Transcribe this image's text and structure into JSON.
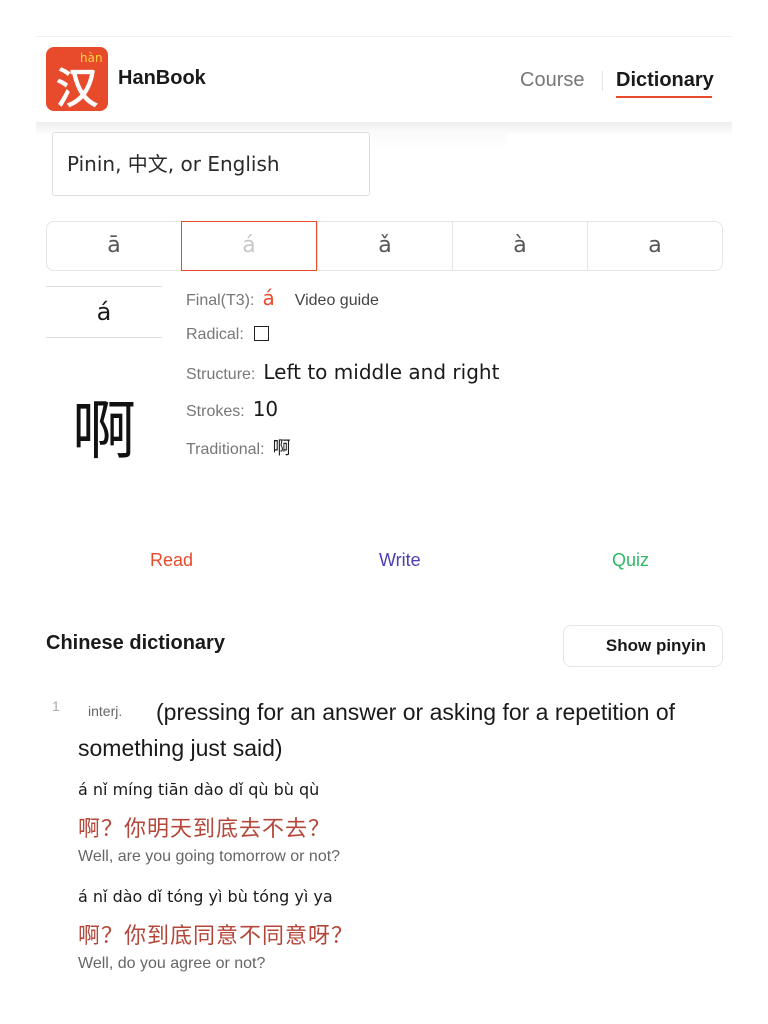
{
  "header": {
    "logo_sup": "hàn",
    "logo_char": "汉",
    "app_name": "HanBook",
    "nav": {
      "course": "Course",
      "dictionary": "Dictionary"
    }
  },
  "search": {
    "placeholder": "Pinin, 中文, or English"
  },
  "tones": [
    "ā",
    "á",
    "ǎ",
    "à",
    "a"
  ],
  "character": {
    "pinyin": "á",
    "glyph": "啊",
    "final_label": "Final(T3):",
    "final_value": "á",
    "video_guide": "Video guide",
    "radical_label": "Radical:",
    "structure_label": "Structure:",
    "structure_value": "Left to middle and right",
    "strokes_label": "Strokes:",
    "strokes_value": "10",
    "traditional_label": "Traditional:",
    "traditional_value": "啊"
  },
  "actions": {
    "read": "Read",
    "write": "Write",
    "quiz": "Quiz"
  },
  "dictionary": {
    "title": "Chinese dictionary",
    "show_pinyin": "Show pinyin",
    "entries": [
      {
        "num": "1",
        "pos": "interj.",
        "definition": "(pressing for an answer or asking for a repetition of something just said)",
        "examples": [
          {
            "pinyin": "á nǐ míng tiān dào dǐ qù bù qù",
            "hanzi": "啊？你明天到底去不去？",
            "english": "Well, are you going tomorrow or not?"
          },
          {
            "pinyin": "á nǐ dào dǐ tóng yì bù tóng yì ya",
            "hanzi": "啊？你到底同意不同意呀？",
            "english": "Well, do you agree or not?"
          }
        ]
      }
    ]
  },
  "colors": {
    "brand": "#e84a2c",
    "write": "#4b3fb5",
    "quiz": "#2fb867",
    "example_hanzi": "#b4473a"
  }
}
